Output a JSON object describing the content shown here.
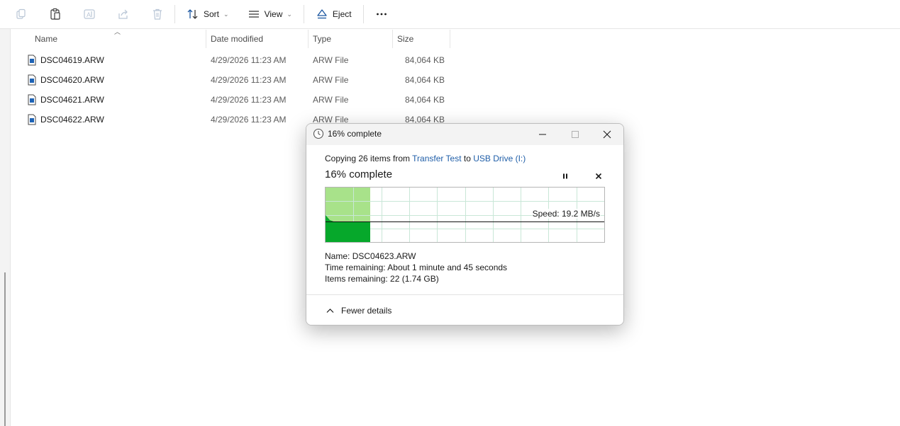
{
  "toolbar": {
    "sort_label": "Sort",
    "view_label": "View",
    "eject_label": "Eject",
    "icons": [
      "copy-icon",
      "paste-icon",
      "rename-icon",
      "share-icon",
      "delete-icon",
      "sort-icon",
      "view-icon",
      "eject-icon",
      "more-icon"
    ]
  },
  "columns": {
    "name": "Name",
    "date": "Date modified",
    "type": "Type",
    "size": "Size"
  },
  "files": [
    {
      "name": "DSC04619.ARW",
      "date": "4/29/2026 11:23 AM",
      "type": "ARW File",
      "size": "84,064 KB"
    },
    {
      "name": "DSC04620.ARW",
      "date": "4/29/2026 11:23 AM",
      "type": "ARW File",
      "size": "84,064 KB"
    },
    {
      "name": "DSC04621.ARW",
      "date": "4/29/2026 11:23 AM",
      "type": "ARW File",
      "size": "84,064 KB"
    },
    {
      "name": "DSC04622.ARW",
      "date": "4/29/2026 11:23 AM",
      "type": "ARW File",
      "size": "84,064 KB"
    }
  ],
  "dialog": {
    "title": "16% complete",
    "copy_prefix": "Copying 26 items from",
    "source": "Transfer Test",
    "to_word": "to",
    "destination": "USB Drive (I:)",
    "percent_text": "16% complete",
    "progress": 0.16,
    "speed": "Speed: 19.2 MB/s",
    "name_label": "Name:",
    "name_value": "DSC04623.ARW",
    "time_label": "Time remaining:",
    "time_value": "About 1 minute and 45 seconds",
    "items_label": "Items remaining:",
    "items_value": "22 (1.74 GB)",
    "fewer_details": "Fewer details"
  },
  "colors": {
    "graph_done": "#a8e28a",
    "graph_fill": "#06a82b",
    "graph_grid": "#c9e7d7",
    "link": "#1f5ea8"
  }
}
